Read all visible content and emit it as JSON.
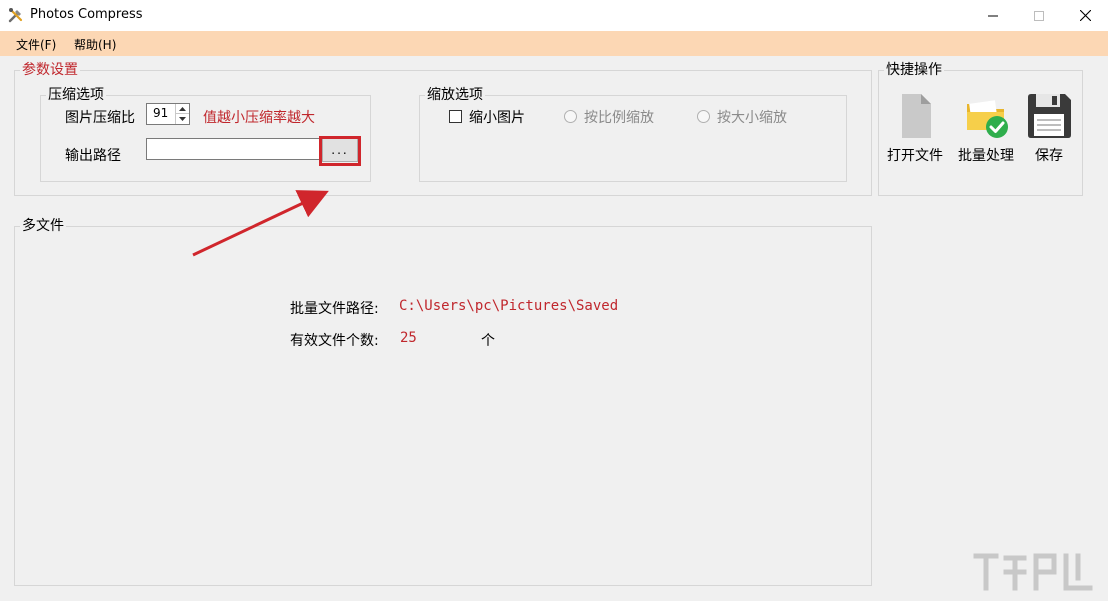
{
  "window": {
    "title": "Photos Compress"
  },
  "menu": {
    "file": "文件(F)",
    "help": "帮助(H)"
  },
  "params": {
    "legend": "参数设置",
    "compress": {
      "legend": "压缩选项",
      "ratio_label": "图片压缩比",
      "ratio_value": "91",
      "hint": "值越小压缩率越大",
      "output_label": "输出路径",
      "output_value": "",
      "browse_label": "..."
    },
    "scale": {
      "legend": "缩放选项",
      "shrink_label": "缩小图片",
      "shrink_checked": false,
      "by_ratio_label": "按比例缩放",
      "by_size_label": "按大小缩放"
    }
  },
  "quick": {
    "legend": "快捷操作",
    "open_label": "打开文件",
    "batch_label": "批量处理",
    "save_label": "保存"
  },
  "multi": {
    "legend": "多文件",
    "path_label": "批量文件路径:",
    "path_value": "C:\\Users\\pc\\Pictures\\Saved",
    "count_label": "有效文件个数:",
    "count_value": "25",
    "count_unit": "个"
  },
  "colors": {
    "menubar": "#fcd7b4",
    "accent_red": "#c0272d",
    "highlight": "#d0262c"
  }
}
